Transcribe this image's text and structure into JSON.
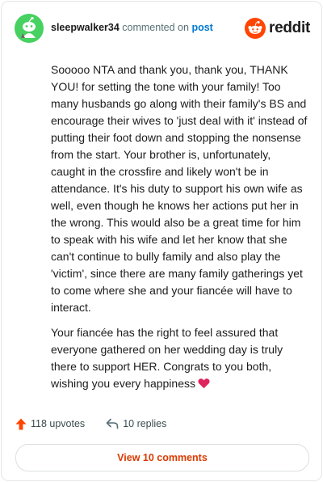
{
  "header": {
    "username": "sleepwalker34",
    "action_text": "commented on",
    "post_link": "post",
    "brand": "reddit"
  },
  "comment": {
    "paragraphs": [
      "Sooooo NTA and thank you, thank you, THANK YOU! for setting the tone with your family! Too many husbands go along with their family's BS and encourage their wives to 'just deal with it' instead of putting their foot down and stopping the nonsense from the start. Your brother is, unfortunately, caught in the crossfire and likely won't be in attendance. It's his duty to support his own wife as well, even though he knows her actions put her in the wrong. This would also be a great time for him to speak with his wife and let her know that she can't continue to bully family and also play the 'victim', since there are many family gatherings yet to come where she and your fiancée will have to interact.",
      "Your fiancée has the right to feel assured that everyone gathered on her wedding day is truly there to support HER. Congrats to you both, wishing you every happiness"
    ]
  },
  "actions": {
    "upvotes": "118 upvotes",
    "replies": "10 replies"
  },
  "view_button": "View 10 comments",
  "colors": {
    "accent": "#ff4500",
    "link": "#0079d3",
    "avatar_bg": "#46d160",
    "heart": "#e0245e"
  },
  "icons": [
    "avatar-icon",
    "reddit-logo-icon",
    "upvote-arrow-icon",
    "reply-arrow-icon",
    "heart-emoji-icon"
  ]
}
